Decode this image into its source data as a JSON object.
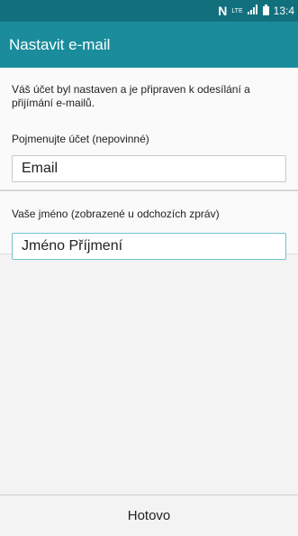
{
  "status_bar": {
    "network_icon": "nfc-n-icon",
    "lte_label": "LTE",
    "signal_icon": "signal-bars-icon",
    "battery_icon": "battery-icon",
    "time": "13:4"
  },
  "app_bar": {
    "title": "Nastavit e-mail"
  },
  "account": {
    "info_text": "Váš účet byl nastaven a je připraven k odesílání a přijímání e-mailů.",
    "name_label": "Pojmenujte účet (nepovinné)",
    "name_value": "Email"
  },
  "sender": {
    "label": "Vaše jméno (zobrazené u odchozích zpráv)",
    "value": "Jméno Příjmení"
  },
  "bottom": {
    "done_label": "Hotovo"
  },
  "colors": {
    "status_bar": "#12707d",
    "app_bar": "#1a8c9b",
    "focus_border": "#76c2cc"
  }
}
